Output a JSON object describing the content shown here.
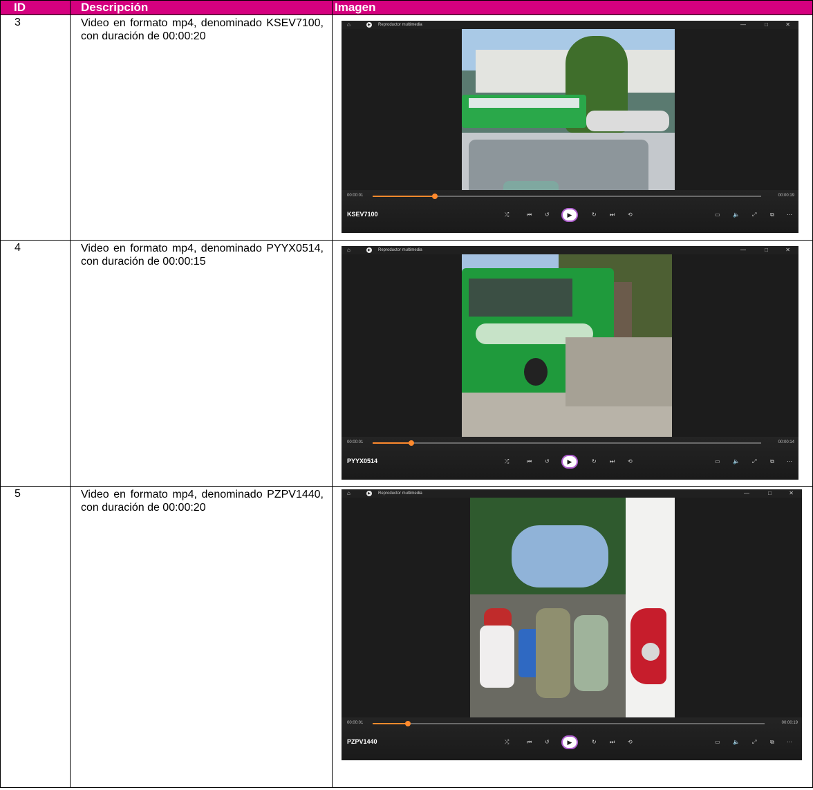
{
  "table": {
    "headers": {
      "id": "ID",
      "description": "Descripción",
      "image": "Imagen"
    },
    "rows": [
      {
        "id": "3",
        "description": "Video en formato mp4, denominado KSEV7100, con duración de 00:00:20",
        "player": {
          "app_title": "Reproductor multimedia",
          "file_name": "KSEV7100",
          "current_time": "00:00:01",
          "total_time": "00:00:19",
          "progress_fraction": 0.16
        }
      },
      {
        "id": "4",
        "description": "Video en formato mp4, denominado PYYX0514, con duración de 00:00:15",
        "player": {
          "app_title": "Reproductor multimedia",
          "file_name": "PYYX0514",
          "current_time": "00:00:01",
          "total_time": "00:00:14",
          "progress_fraction": 0.1
        }
      },
      {
        "id": "5",
        "description": "Video en formato mp4, denominado PZPV1440, con duración de 00:00:20",
        "player": {
          "app_title": "Reproductor multimedia",
          "file_name": "PZPV1440",
          "current_time": "00:00:01",
          "total_time": "00:00:19",
          "progress_fraction": 0.09
        }
      }
    ]
  },
  "colors": {
    "header_bg": "#d5007f",
    "header_text": "#ffffff",
    "progress_accent": "#ff8a2d",
    "play_ring": "#b05fd0"
  },
  "icons": [
    "home-icon",
    "app-logo-icon",
    "minimize-icon",
    "maximize-icon",
    "close-icon",
    "shuffle-icon",
    "previous-icon",
    "rewind-icon",
    "play-icon",
    "forward-icon",
    "next-icon",
    "repeat-icon",
    "captions-icon",
    "volume-icon",
    "fullscreen-icon",
    "miniplayer-icon",
    "more-icon"
  ]
}
